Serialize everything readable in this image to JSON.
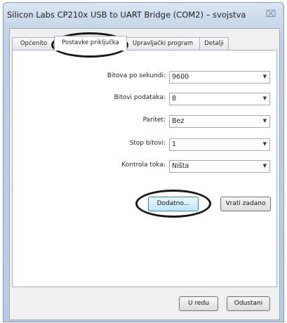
{
  "window": {
    "title": "Silicon Labs CP210x USB to UART Bridge (COM2) – svojstva",
    "close_glyph": "⌧"
  },
  "tabs": [
    {
      "label": "Općenito",
      "active": false
    },
    {
      "label": "Postavke priključka",
      "active": true
    },
    {
      "label": "Upravljački program",
      "active": false
    },
    {
      "label": "Detalji",
      "active": false
    }
  ],
  "settings": {
    "bits_per_second": {
      "label": "Bitova po sekundi:",
      "value": "9600"
    },
    "data_bits": {
      "label": "Bitovi podataka:",
      "value": "8"
    },
    "parity": {
      "label": "Paritet:",
      "value": "Bez"
    },
    "stop_bits": {
      "label": "Stop bitovi:",
      "value": "1"
    },
    "flow_control": {
      "label": "Kontrola toka:",
      "value": "Ništa"
    }
  },
  "buttons": {
    "advanced": "Dodatno...",
    "restore_defaults": "Vrati zadano",
    "ok": "U redu",
    "cancel": "Odustani"
  },
  "icons": {
    "dropdown_arrow": "▼",
    "close": "close-icon"
  }
}
